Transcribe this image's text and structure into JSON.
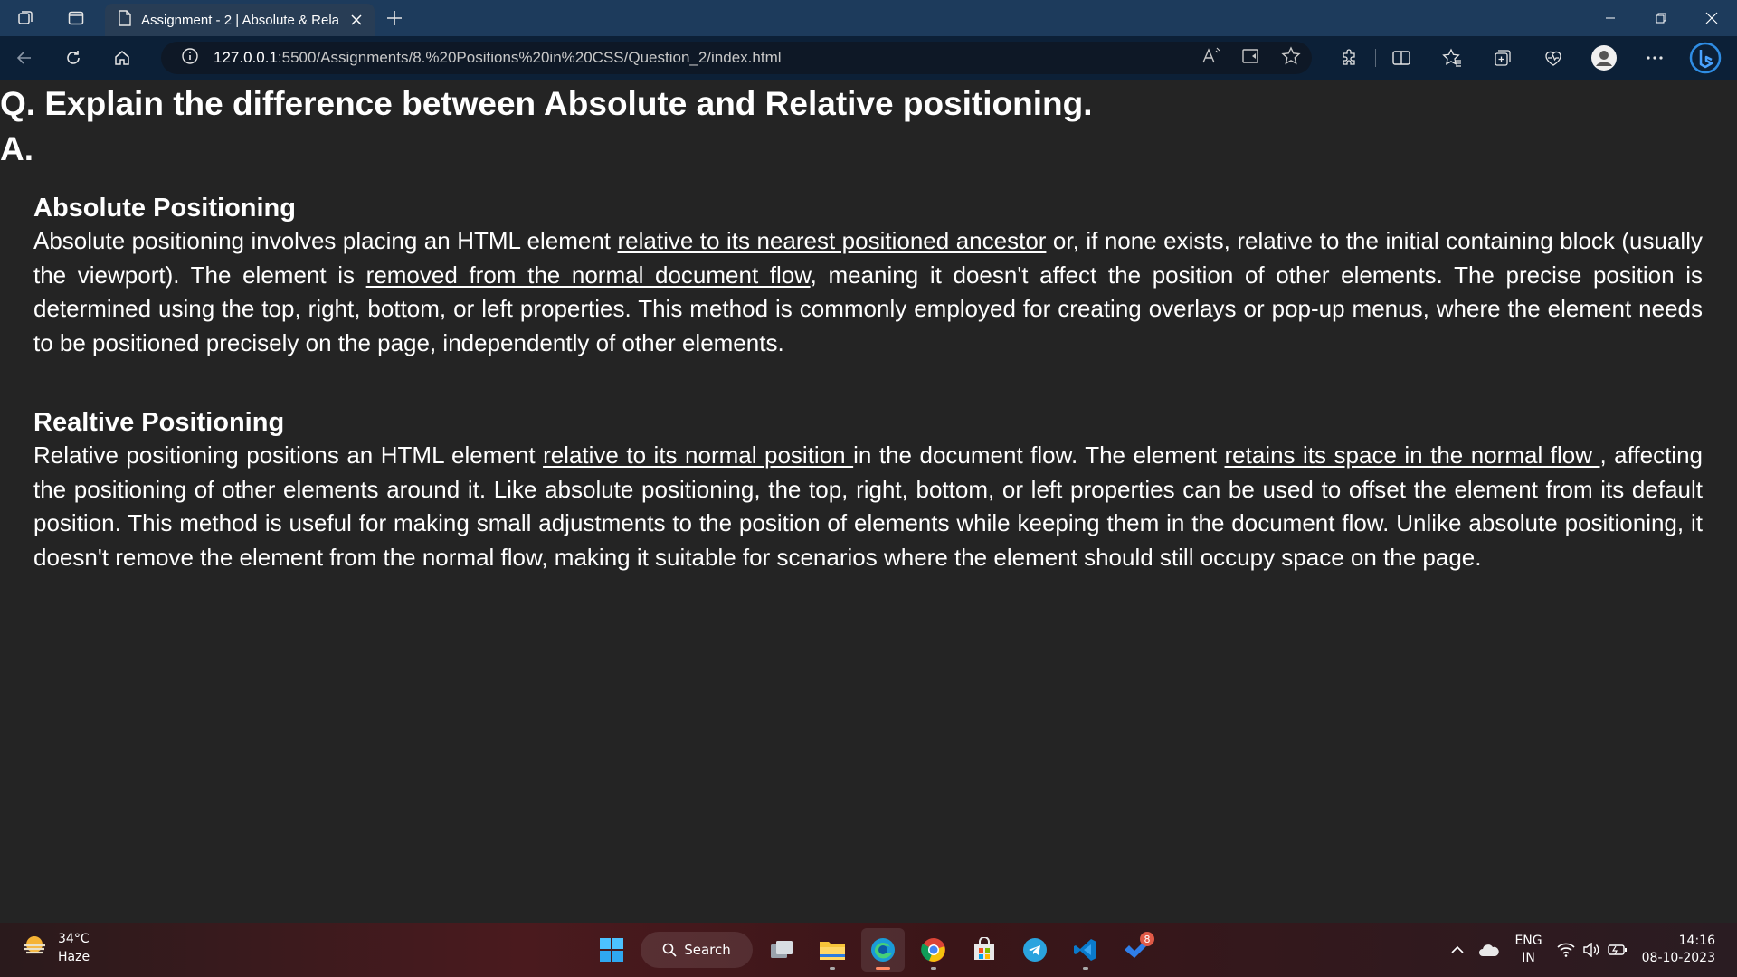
{
  "browser": {
    "tab": {
      "title": "Assignment - 2 | Absolute & Rela"
    },
    "address": {
      "host": "127.0.0.1",
      "path": ":5500/Assignments/8.%20Positions%20in%20CSS/Question_2/index.html"
    },
    "toolbar_icons": [
      "read-aloud-icon",
      "immersive-reader-icon",
      "favorite-star-icon",
      "extensions-icon",
      "split-screen-icon",
      "favorites-icon",
      "collections-icon",
      "performance-icon",
      "profile-icon",
      "more-icon",
      "bing-copilot-icon"
    ]
  },
  "page": {
    "question": "Q. Explain the difference between Absolute and Relative positioning.",
    "answer_label": "A.",
    "sections": [
      {
        "heading": "Absolute Positioning",
        "parts": [
          "Absolute positioning involves placing an HTML element ",
          "relative to its nearest positioned ancestor",
          " or, if none exists, relative to the initial containing block (usually the viewport). The element is ",
          "removed from the normal document flow",
          ", meaning it doesn't affect the position of other elements. The precise position is determined using the top, right, bottom, or left properties. This method is commonly employed for creating overlays or pop-up menus, where the element needs to be positioned precisely on the page, independently of other elements."
        ]
      },
      {
        "heading": "Realtive Positioning",
        "parts": [
          "Relative positioning positions an HTML element ",
          "relative to its normal position ",
          "in the document flow. The element ",
          "retains its space in the normal flow ",
          ", affecting the positioning of other elements around it. Like absolute positioning, the top, right, bottom, or left properties can be used to offset the element from its default position. This method is useful for making small adjustments to the position of elements while keeping them in the document flow. Unlike absolute positioning, it doesn't remove the element from the normal flow, making it suitable for scenarios where the element should still occupy space on the page."
        ]
      }
    ]
  },
  "taskbar": {
    "weather": {
      "temp": "34°C",
      "condition": "Haze"
    },
    "search_label": "Search",
    "todo_badge": "8",
    "lang": {
      "line1": "ENG",
      "line2": "IN"
    },
    "clock": {
      "time": "14:16",
      "date": "08-10-2023"
    }
  },
  "colors": {
    "page_bg": "#242424",
    "titlebar_bg": "#1d3b5c",
    "addressbar_bg": "#0c2037",
    "text": "#ffffff"
  }
}
